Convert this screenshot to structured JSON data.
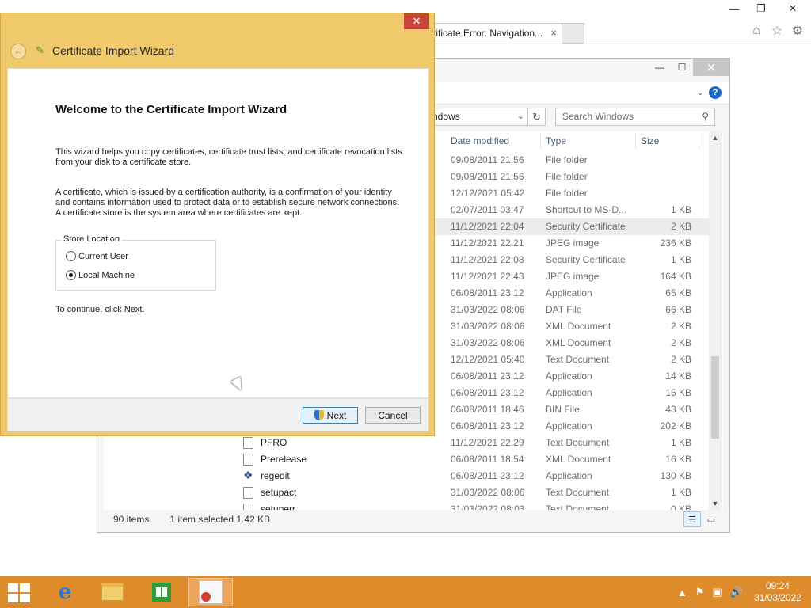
{
  "browser": {
    "tab_title": "rtificate Error: Navigation...",
    "tab_close": "×",
    "min": "—",
    "restore": "❐",
    "close": "✕",
    "icons": [
      "⌂",
      "☆",
      "⚙"
    ]
  },
  "explorer": {
    "address": "ndows",
    "search_placeholder": "Search Windows",
    "columns": {
      "date": "Date modified",
      "type": "Type",
      "size": "Size"
    },
    "rows": [
      {
        "name": "",
        "date": "09/08/2011 21:56",
        "type": "File folder",
        "size": ""
      },
      {
        "name": "",
        "date": "09/08/2011 21:56",
        "type": "File folder",
        "size": ""
      },
      {
        "name": "",
        "date": "12/12/2021 05:42",
        "type": "File folder",
        "size": ""
      },
      {
        "name": "",
        "date": "02/07/2011 03:47",
        "type": "Shortcut to MS-D...",
        "size": "1 KB"
      },
      {
        "name": "",
        "date": "11/12/2021 22:04",
        "type": "Security Certificate",
        "size": "2 KB"
      },
      {
        "name": "",
        "date": "11/12/2021 22:21",
        "type": "JPEG image",
        "size": "236 KB"
      },
      {
        "name": "",
        "date": "11/12/2021 22:08",
        "type": "Security Certificate",
        "size": "1 KB"
      },
      {
        "name": "",
        "date": "11/12/2021 22:43",
        "type": "JPEG image",
        "size": "164 KB"
      },
      {
        "name": "",
        "date": "06/08/2011 23:12",
        "type": "Application",
        "size": "65 KB"
      },
      {
        "name": "",
        "date": "31/03/2022 08:06",
        "type": "DAT File",
        "size": "66 KB"
      },
      {
        "name": "",
        "date": "31/03/2022 08:06",
        "type": "XML Document",
        "size": "2 KB"
      },
      {
        "name": "",
        "date": "31/03/2022 08:06",
        "type": "XML Document",
        "size": "2 KB"
      },
      {
        "name": "",
        "date": "12/12/2021 05:40",
        "type": "Text Document",
        "size": "2 KB"
      },
      {
        "name": "",
        "date": "06/08/2011 23:12",
        "type": "Application",
        "size": "14 KB"
      },
      {
        "name": "",
        "date": "06/08/2011 23:12",
        "type": "Application",
        "size": "15 KB"
      },
      {
        "name": "",
        "date": "06/08/2011 18:46",
        "type": "BIN File",
        "size": "43 KB"
      },
      {
        "name": "",
        "date": "06/08/2011 23:12",
        "type": "Application",
        "size": "202 KB"
      },
      {
        "name": "PFRO",
        "date": "11/12/2021 22:29",
        "type": "Text Document",
        "size": "1 KB"
      },
      {
        "name": "Prerelease",
        "date": "06/08/2011 18:54",
        "type": "XML Document",
        "size": "16 KB"
      },
      {
        "name": "regedit",
        "date": "06/08/2011 23:12",
        "type": "Application",
        "size": "130 KB"
      },
      {
        "name": "setupact",
        "date": "31/03/2022 08:06",
        "type": "Text Document",
        "size": "1 KB"
      },
      {
        "name": "setuperr",
        "date": "31/03/2022 08:03",
        "type": "Text Document",
        "size": "0 KB"
      }
    ],
    "status_items": "90 items",
    "status_selected": "1 item selected  1.42 KB"
  },
  "wizard": {
    "title": "Certificate Import Wizard",
    "close": "✕",
    "heading": "Welcome to the Certificate Import Wizard",
    "para1": "This wizard helps you copy certificates, certificate trust lists, and certificate revocation lists from your disk to a certificate store.",
    "para2": "A certificate, which is issued by a certification authority, is a confirmation of your identity and contains information used to protect data or to establish secure network connections. A certificate store is the system area where certificates are kept.",
    "store_location": "Store Location",
    "option_current_user": "Current User",
    "option_local_machine": "Local Machine",
    "selected_option": "Local Machine",
    "continue_text": "To continue, click Next.",
    "next_label": "Next",
    "cancel_label": "Cancel"
  },
  "taskbar": {
    "time": "09:24",
    "date": "31/03/2022",
    "ie_glyph": "e"
  }
}
